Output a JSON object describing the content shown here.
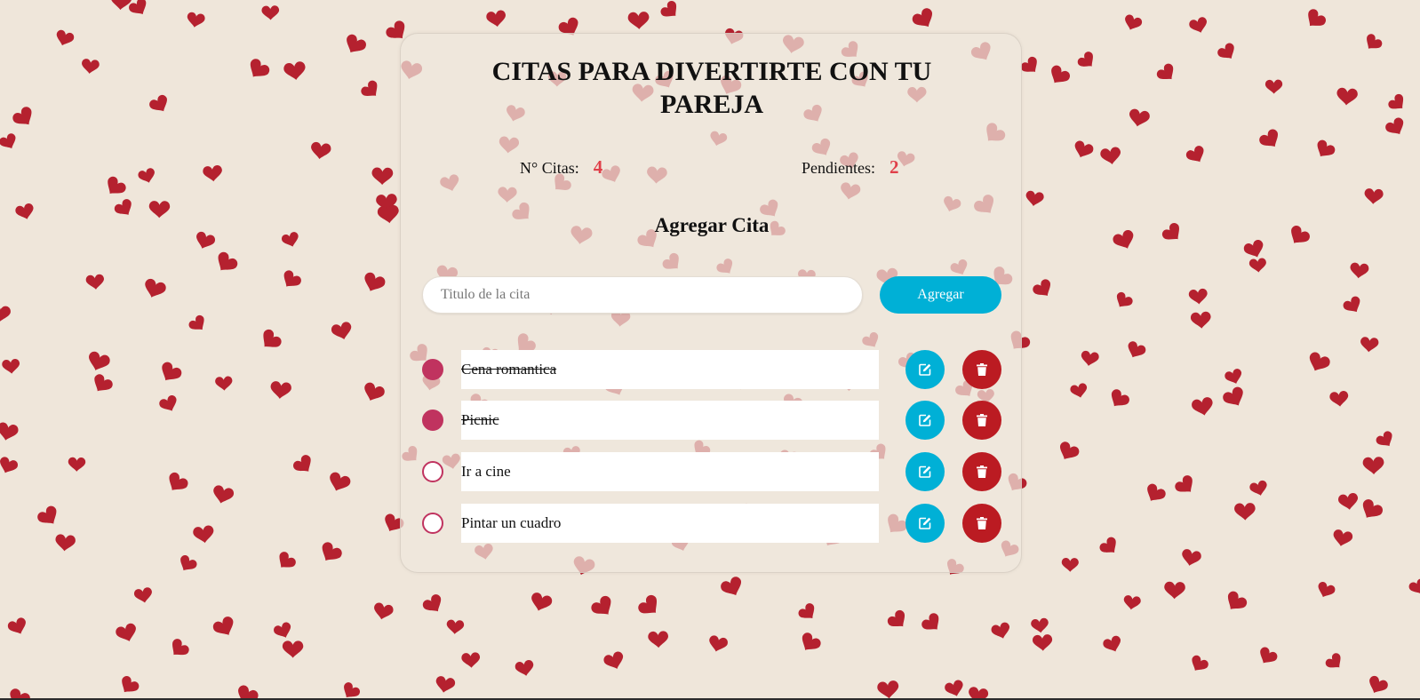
{
  "app": {
    "title": "CITAS PARA DIVERTIRTE CON TU PAREJA"
  },
  "stats": {
    "total_label": "N° Citas:",
    "total_value": "4",
    "pending_label": "Pendientes:",
    "pending_value": "2"
  },
  "form": {
    "heading": "Agregar Cita",
    "input_placeholder": "Titulo de la cita",
    "input_value": "",
    "add_label": "Agregar"
  },
  "items": [
    {
      "title": "Cena romantica",
      "done": true
    },
    {
      "title": "Picnic",
      "done": true
    },
    {
      "title": "Ir a cine",
      "done": false
    },
    {
      "title": "Pintar un cuadro",
      "done": false
    }
  ],
  "icons": {
    "edit": "edit-icon",
    "delete": "trash-icon",
    "background": "heart-icon"
  },
  "colors": {
    "background": "#efe6da",
    "heart": "#b5212f",
    "accent": "#00b0d6",
    "danger": "#bb1b22",
    "check": "#c0335f",
    "stat_value": "#e0404a"
  }
}
